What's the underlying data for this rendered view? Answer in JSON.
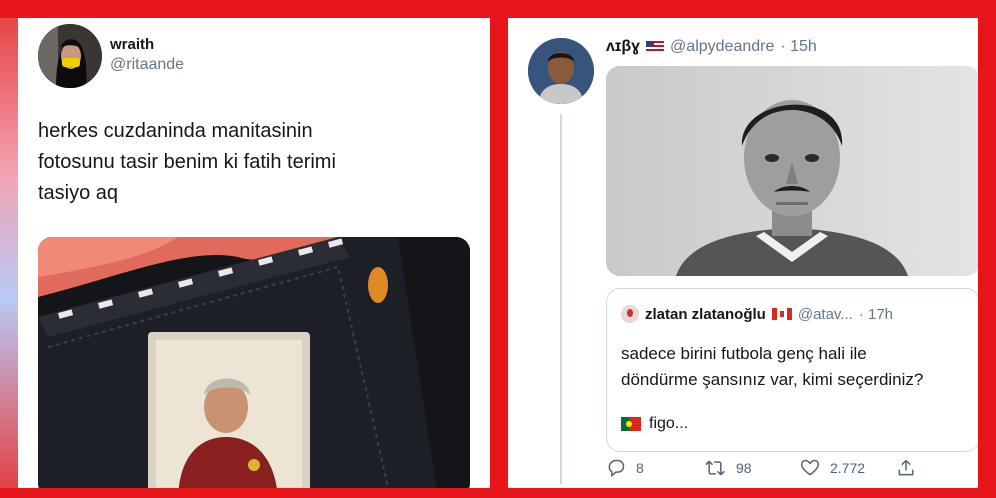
{
  "left_tweet": {
    "display_name": "wraith",
    "handle": "@ritaande",
    "text": "herkes cuzdaninda manitasinin\nfotosunu tasir benim ki fatih terimi\ntasiyo aq",
    "avatar_icon": "profile-photo-masked-woman",
    "media": "wallet-with-photo"
  },
  "right_tweet": {
    "display_name": "ʌɪβɣ",
    "flag": "us-flag-icon",
    "handle": "@alpydeandre",
    "time": "· 15h",
    "avatar_icon": "profile-photo-footballer",
    "media": "black-and-white-footballer-portrait",
    "quote": {
      "display_name": "zlatan zlatanoğlu",
      "flag": "canada-flag-icon",
      "handle": "@atav...",
      "time": "· 17h",
      "text": "sadece birini futbola genç hali ile\ndöndürme şansınız var, kimi seçerdiniz?",
      "reply_flag": "portugal-flag-icon",
      "reply_text": "figo..."
    },
    "actions": {
      "replies": "8",
      "retweets": "98",
      "likes": "2.772"
    }
  },
  "colors": {
    "frame_red": "#e8161b",
    "text_primary": "#14171a",
    "text_secondary": "#657786",
    "border": "#cfd9de"
  }
}
